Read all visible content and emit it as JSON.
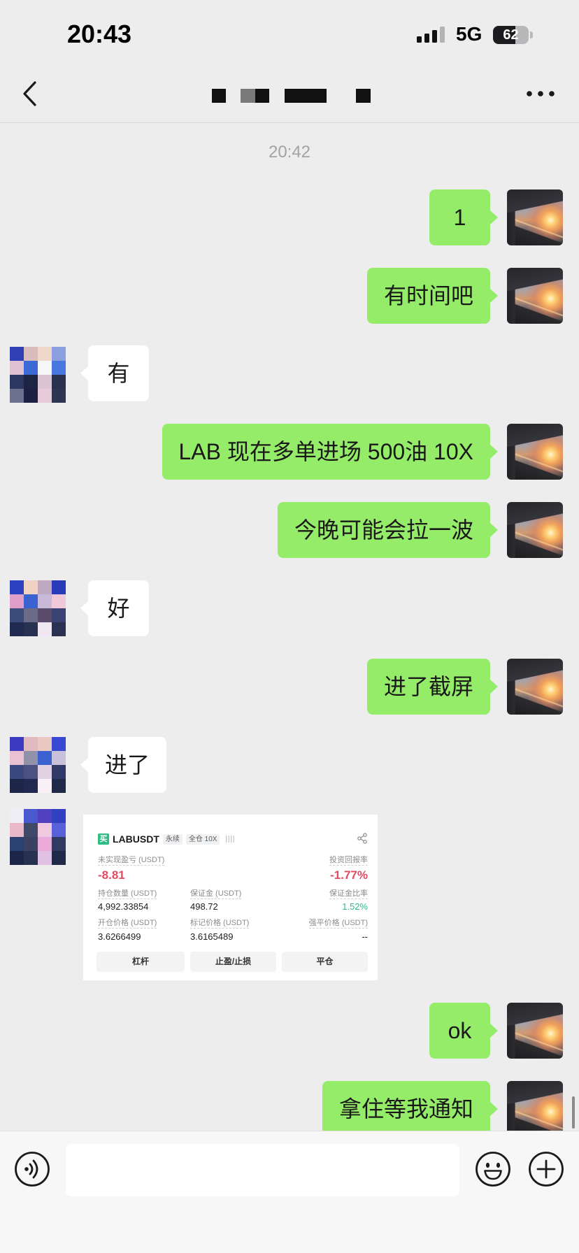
{
  "status_bar": {
    "time": "20:43",
    "network": "5G",
    "battery": "62",
    "signal_icon": "cellular-signal-icon",
    "battery_icon": "battery-icon"
  },
  "nav": {
    "back_icon": "chevron-left-icon",
    "more_icon": "more-horizontal-icon"
  },
  "chat": {
    "timestamp": "20:42",
    "messages": [
      {
        "text": "1"
      },
      {
        "text": "有时间吧"
      },
      {
        "text": "有"
      },
      {
        "text": "LAB 现在多单进场 500油 10X"
      },
      {
        "text": "今晚可能会拉一波"
      },
      {
        "text": "好"
      },
      {
        "text": "进了截屏"
      },
      {
        "text": "进了"
      },
      {
        "text": "ok"
      },
      {
        "text": "拿住等我通知"
      }
    ],
    "bubble_colors": {
      "outgoing": "#95ec69",
      "incoming": "#ffffff"
    }
  },
  "position_card": {
    "side_badge": "买",
    "symbol": "LABUSDT",
    "tag_contract": "永续",
    "tag_margin": "全仓 10X",
    "unrealized_pnl": {
      "label": "未实现盈亏 (USDT)",
      "value": "-8.81"
    },
    "roi": {
      "label": "投资回报率",
      "value": "-1.77%"
    },
    "position_size": {
      "label": "持仓数量 (USDT)",
      "value": "4,992.33854"
    },
    "margin": {
      "label": "保证金 (USDT)",
      "value": "498.72"
    },
    "margin_ratio": {
      "label": "保证金比率",
      "value": "1.52%"
    },
    "entry_price": {
      "label": "开仓价格 (USDT)",
      "value": "3.6266499"
    },
    "mark_price": {
      "label": "标记价格 (USDT)",
      "value": "3.6165489"
    },
    "liq_price": {
      "label": "强平价格 (USDT)",
      "value": "--"
    },
    "buttons": {
      "leverage": "杠杆",
      "tp_sl": "止盈/止损",
      "close": "平仓"
    },
    "colors": {
      "loss": "#e04a62",
      "profit": "#2ebd85"
    }
  },
  "input_bar": {
    "voice_icon": "voice-input-icon",
    "emoji_icon": "emoji-icon",
    "plus_icon": "plus-circle-icon",
    "input_value": ""
  }
}
